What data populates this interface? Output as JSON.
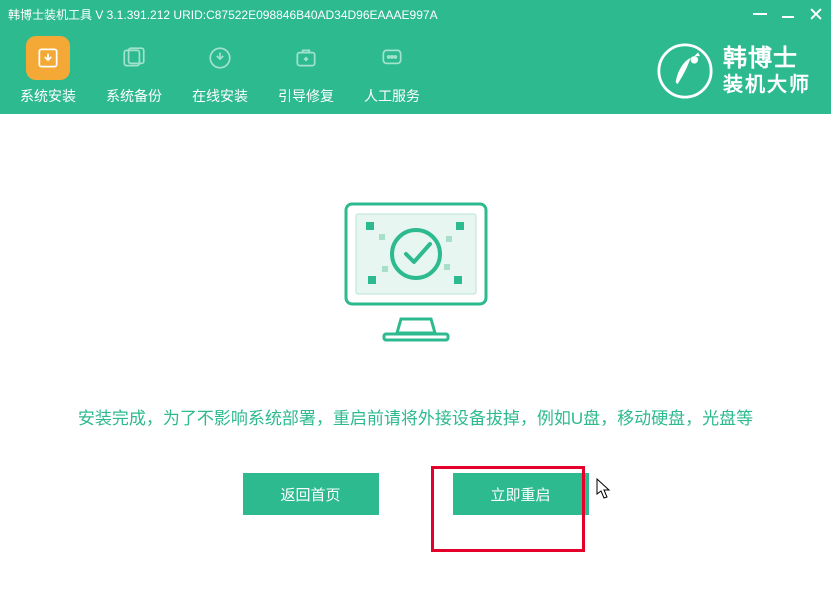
{
  "header": {
    "title": "韩博士装机工具 V 3.1.391.212 URID:C87522E098846B40AD34D96EAAAE997A"
  },
  "nav": {
    "items": [
      {
        "label": "系统安装"
      },
      {
        "label": "系统备份"
      },
      {
        "label": "在线安装"
      },
      {
        "label": "引导修复"
      },
      {
        "label": "人工服务"
      }
    ]
  },
  "brand": {
    "line1": "韩博士",
    "line2": "装机大师"
  },
  "content": {
    "message": "安装完成，为了不影响系统部署，重启前请将外接设备拔掉，例如U盘，移动硬盘，光盘等"
  },
  "buttons": {
    "back": "返回首页",
    "restart": "立即重启"
  }
}
